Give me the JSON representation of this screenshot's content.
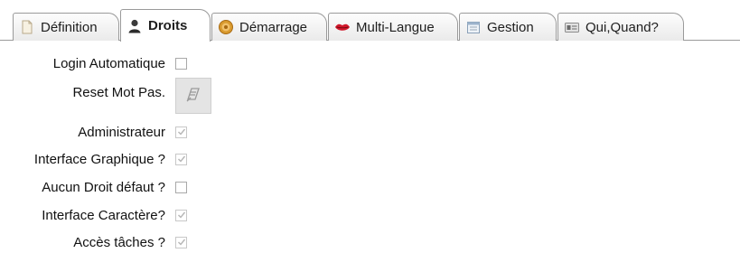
{
  "tabs": [
    {
      "label": "Définition",
      "icon": "document-icon",
      "active": false
    },
    {
      "label": "Droits",
      "icon": "user-icon",
      "active": true
    },
    {
      "label": "Démarrage",
      "icon": "gear-icon",
      "active": false
    },
    {
      "label": "Multi-Langue",
      "icon": "lips-icon",
      "active": false
    },
    {
      "label": "Gestion",
      "icon": "calendar-icon",
      "active": false
    },
    {
      "label": "Qui,Quand?",
      "icon": "id-card-icon",
      "active": false
    }
  ],
  "form": {
    "login_auto": {
      "label": "Login Automatique",
      "checked": false
    },
    "reset_password": {
      "label": "Reset Mot Pas.",
      "icon": "reset-password-icon"
    },
    "administrator": {
      "label": "Administrateur",
      "checked": true
    },
    "graphic_interface": {
      "label": "Interface Graphique ?",
      "checked": true
    },
    "no_default_rights": {
      "label": "Aucun Droit défaut ?",
      "checked": false
    },
    "char_interface": {
      "label": "Interface Caractère?",
      "checked": true
    },
    "task_access": {
      "label": "Accès tâches ?",
      "checked": true
    }
  },
  "colors": {
    "border": "#9a9a9a",
    "check_disabled": "#b5b5b5",
    "button_bg": "#e4e4e4"
  }
}
